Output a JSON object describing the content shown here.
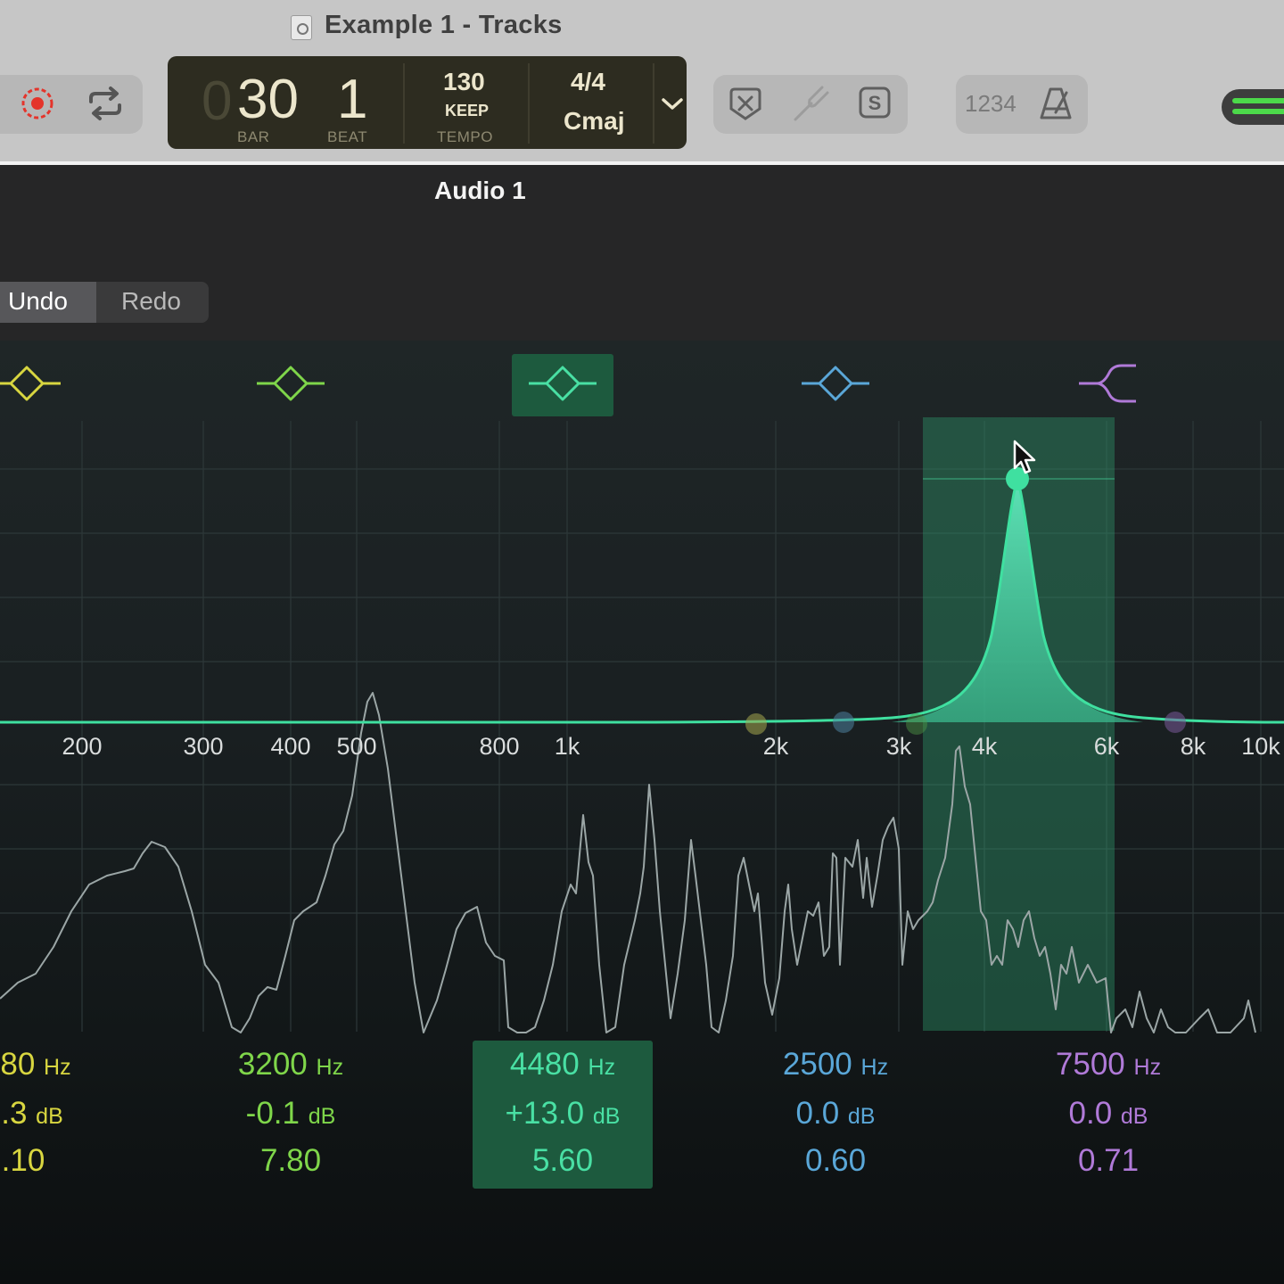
{
  "window": {
    "title": "Example 1 - Tracks"
  },
  "lcd": {
    "bar": "30",
    "bar_ghost": "0",
    "bar_label": "BAR",
    "beat": "1",
    "beat_label": "BEAT",
    "tempo": "130",
    "tempo_mode": "KEEP",
    "tempo_label": "TEMPO",
    "signature": "4/4",
    "key": "Cmaj"
  },
  "toolbar": {
    "count_in": "1234"
  },
  "track": {
    "name": "Audio 1"
  },
  "edit": {
    "undo_label": "Undo",
    "redo_label": "Redo"
  },
  "eq": {
    "frequency_labels": [
      "200",
      "300",
      "400",
      "500",
      "800",
      "1k",
      "2k",
      "3k",
      "4k",
      "6k",
      "8k",
      "10k"
    ],
    "bands": [
      {
        "color": "#d8d640",
        "type": "bell",
        "freq": "80",
        "gain": ".3",
        "q": ".10"
      },
      {
        "color": "#7fd64a",
        "type": "bell",
        "freq": "3200",
        "gain": "-0.1",
        "q": "7.80"
      },
      {
        "color": "#49e0a4",
        "type": "bell",
        "freq": "4480",
        "gain": "+13.0",
        "q": "5.60",
        "selected": true
      },
      {
        "color": "#5aa7d8",
        "type": "bell",
        "freq": "2500",
        "gain": "0.0",
        "q": "0.60"
      },
      {
        "color": "#b07ad8",
        "type": "high-shelf",
        "freq": "7500",
        "gain": "0.0",
        "q": "0.71"
      }
    ],
    "units": {
      "freq": "Hz",
      "gain": "dB"
    },
    "accent": "#3fe0a0"
  }
}
